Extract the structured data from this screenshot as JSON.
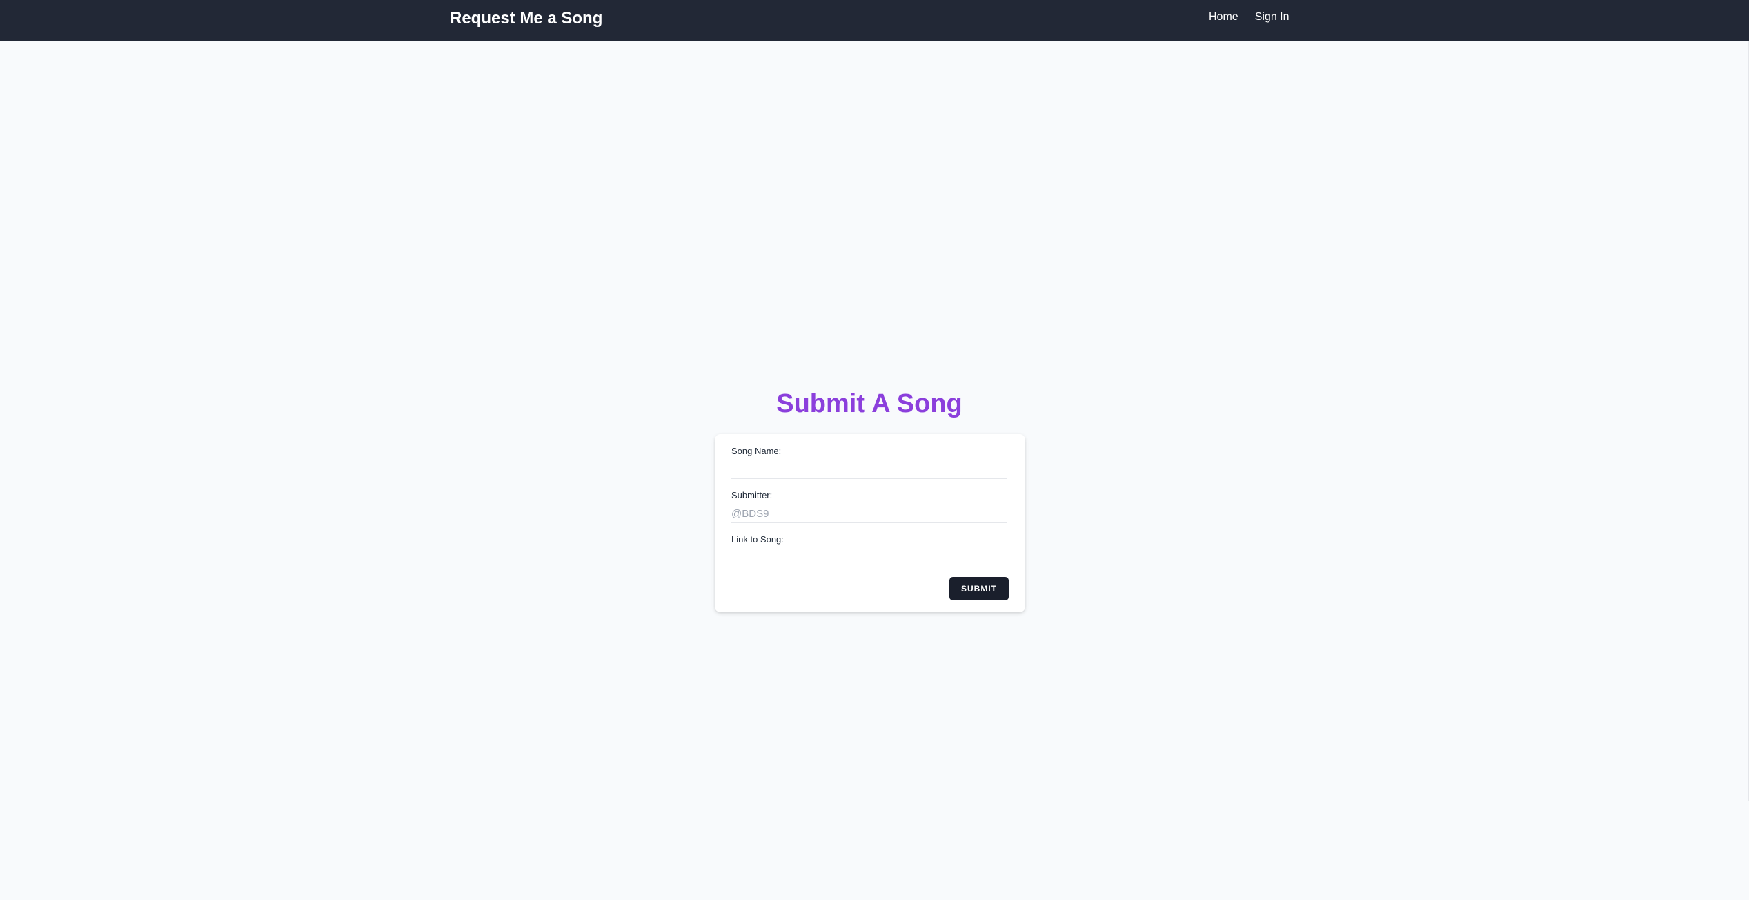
{
  "navbar": {
    "brand": "Request Me a Song",
    "links": [
      {
        "label": "Home"
      },
      {
        "label": "Sign In"
      }
    ]
  },
  "main": {
    "title": "Submit A Song",
    "form": {
      "song_name": {
        "label": "Song Name:",
        "value": "",
        "placeholder": ""
      },
      "submitter": {
        "label": "Submitter:",
        "value": "",
        "placeholder": "@BDS9"
      },
      "link": {
        "label": "Link to Song:",
        "value": "",
        "placeholder": ""
      },
      "submit_label": "SUBMIT"
    }
  },
  "colors": {
    "navbar_bg": "#222836",
    "page_bg": "#f8fafc",
    "title": "#8b3fdc",
    "button_bg": "#1a1f2c"
  }
}
